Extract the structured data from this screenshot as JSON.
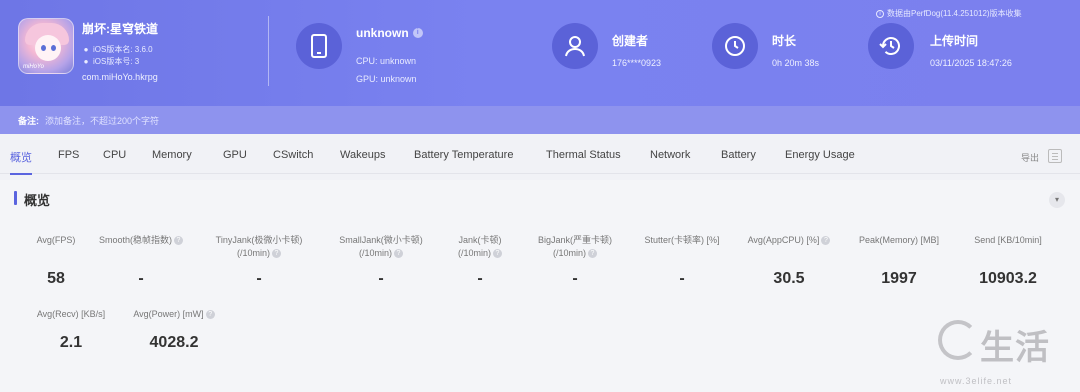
{
  "header": {
    "game_name": "崩坏:星穹铁道",
    "ios_version": "iOS版本名: 3.6.0",
    "ios_build": "iOS版本号: 3",
    "package": "com.miHoYo.hkrpg",
    "icon_tag": "miHoYo",
    "device_name": "unknown",
    "cpu": "CPU: unknown",
    "gpu": "GPU: unknown",
    "creator_label": "创建者",
    "creator_value": "176****0923",
    "duration_label": "时长",
    "duration_value": "0h 20m 38s",
    "upload_label": "上传时间",
    "upload_value": "03/11/2025 18:47:26",
    "perfdog_note": "数据由PerfDog(11.4.251012)版本收集",
    "remark_label": "备注:",
    "remark_placeholder": "添加备注，不超过200个字符",
    "accent_color": "#7b80ee"
  },
  "tabs": [
    {
      "label": "概览",
      "active": true
    },
    {
      "label": "FPS"
    },
    {
      "label": "CPU"
    },
    {
      "label": "Memory"
    },
    {
      "label": "GPU"
    },
    {
      "label": "CSwitch"
    },
    {
      "label": "Wakeups"
    },
    {
      "label": "Battery Temperature"
    },
    {
      "label": "Thermal Status"
    },
    {
      "label": "Network"
    },
    {
      "label": "Battery"
    },
    {
      "label": "Energy Usage"
    }
  ],
  "export_label": "导出",
  "summary": {
    "title": "概览",
    "metrics": [
      {
        "label1": "Avg(FPS)",
        "label2": "",
        "value": "58"
      },
      {
        "label1": "Smooth(稳帧指数)",
        "label2": "",
        "value": "-"
      },
      {
        "label1": "TinyJank(极微小卡顿)",
        "label2": "(/10min)",
        "value": "-"
      },
      {
        "label1": "SmallJank(微小卡顿)",
        "label2": "(/10min)",
        "value": "-"
      },
      {
        "label1": "Jank(卡顿)",
        "label2": "(/10min)",
        "value": "-"
      },
      {
        "label1": "BigJank(严重卡顿)",
        "label2": "(/10min)",
        "value": "-"
      },
      {
        "label1": "Stutter(卡顿率) [%]",
        "label2": "",
        "value": "-"
      },
      {
        "label1": "Avg(AppCPU) [%]",
        "label2": "",
        "value": "30.5"
      },
      {
        "label1": "Peak(Memory) [MB]",
        "label2": "",
        "value": "1997"
      },
      {
        "label1": "Send [KB/10min]",
        "label2": "",
        "value": "10903.2"
      },
      {
        "label1": "Avg(Recv) [KB/s]",
        "label2": "",
        "value": "2.1"
      },
      {
        "label1": "Avg(Power) [mW]",
        "label2": "",
        "value": "4028.2"
      }
    ]
  },
  "watermark": {
    "text": "生活",
    "url": "www.3elife.net"
  }
}
